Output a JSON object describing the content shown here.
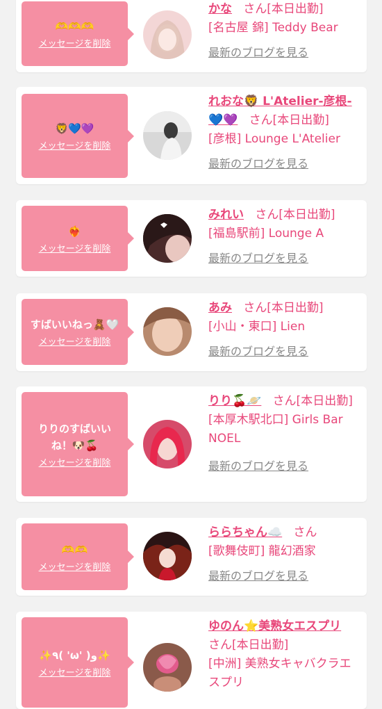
{
  "cards": [
    {
      "message": "🫶🫶🫶",
      "delete_label": "メッセージを削除",
      "name": "かな",
      "suffix": "さん[本日出勤]",
      "shop": "[名古屋 錦] Teddy Bear",
      "blog_label": "最新のブログを見る"
    },
    {
      "message": "🦁💙💜",
      "delete_label": "メッセージを削除",
      "name": "れおな🦁 L'Atelier-彦根-💙💜",
      "suffix": "さん[本日出勤]",
      "shop": "[彦根] Lounge L'Atelier",
      "blog_label": "最新のブログを見る"
    },
    {
      "message": "❤️‍🔥",
      "delete_label": "メッセージを削除",
      "name": "みれい",
      "suffix": "さん[本日出勤]",
      "shop": "[福島駅前] Lounge A",
      "blog_label": "最新のブログを見る"
    },
    {
      "message": "すばいいねっ🧸🤍",
      "delete_label": "メッセージを削除",
      "name": "あみ",
      "suffix": "さん[本日出勤]",
      "shop": "[小山・東口] Lien",
      "blog_label": "最新のブログを見る"
    },
    {
      "message": "りりのすばいいね！🐶🍒",
      "delete_label": "メッセージを削除",
      "name": "りり🍒🪐",
      "suffix": "さん[本日出勤]",
      "shop": "[本厚木駅北口] Girls Bar NOEL",
      "blog_label": "最新のブログを見る"
    },
    {
      "message": "🫶🫶",
      "delete_label": "メッセージを削除",
      "name": "ららちゃん☁️",
      "suffix": "さん",
      "shop": "[歌舞伎町] 龍幻酒家",
      "blog_label": "最新のブログを見る"
    },
    {
      "message": "✨٩( 'ω' )و✨",
      "delete_label": "メッセージを削除",
      "name": "ゆのん⭐美熟女エスプリ",
      "suffix": "さん[本日出勤]",
      "shop": "[中洲] 美熟女キャバクラエスプリ",
      "blog_label": ""
    }
  ],
  "colors": {
    "bubble": "#f58fa3",
    "accent_text": "#e8477a",
    "link_gray": "#888888",
    "page_bg": "#f2f2f2"
  }
}
